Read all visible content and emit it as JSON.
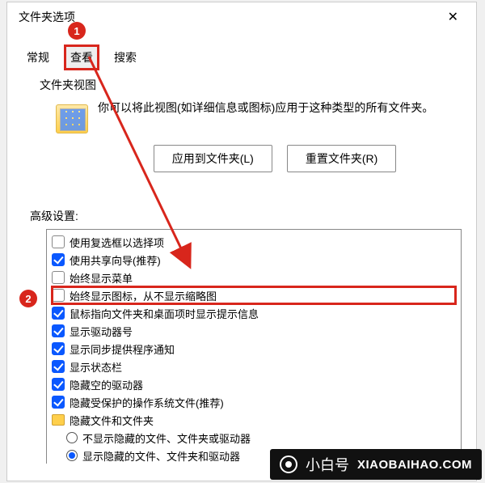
{
  "dialog": {
    "title": "文件夹选项",
    "close_tooltip": "关闭"
  },
  "tabs": {
    "general": "常规",
    "view": "查看",
    "search": "搜索"
  },
  "folder_views": {
    "group_label": "文件夹视图",
    "description": "你可以将此视图(如详细信息或图标)应用于这种类型的所有文件夹。",
    "apply_btn": "应用到文件夹(L)",
    "reset_btn": "重置文件夹(R)"
  },
  "advanced": {
    "label": "高级设置:",
    "items": [
      {
        "kind": "check",
        "checked": false,
        "label": "使用复选框以选择项"
      },
      {
        "kind": "check",
        "checked": true,
        "label": "使用共享向导(推荐)"
      },
      {
        "kind": "check",
        "checked": false,
        "label": "始终显示菜单"
      },
      {
        "kind": "check",
        "checked": false,
        "label": "始终显示图标，从不显示缩略图",
        "highlight": true
      },
      {
        "kind": "check",
        "checked": true,
        "label": "鼠标指向文件夹和桌面项时显示提示信息"
      },
      {
        "kind": "check",
        "checked": true,
        "label": "显示驱动器号"
      },
      {
        "kind": "check",
        "checked": true,
        "label": "显示同步提供程序通知"
      },
      {
        "kind": "check",
        "checked": true,
        "label": "显示状态栏"
      },
      {
        "kind": "check",
        "checked": true,
        "label": "隐藏空的驱动器"
      },
      {
        "kind": "check",
        "checked": true,
        "label": "隐藏受保护的操作系统文件(推荐)"
      },
      {
        "kind": "folder",
        "label": "隐藏文件和文件夹"
      },
      {
        "kind": "radio",
        "selected": false,
        "indent": 1,
        "label": "不显示隐藏的文件、文件夹或驱动器"
      },
      {
        "kind": "radio",
        "selected": true,
        "indent": 1,
        "label": "显示隐藏的文件、文件夹和驱动器"
      }
    ]
  },
  "annotations": {
    "step1": "1",
    "step2": "2"
  },
  "watermark": {
    "cn": "@小白号",
    "en": "XIAOBAIHAO.COM"
  },
  "brand": {
    "cn": "小白号",
    "en": "XIAOBAIHAO.COM"
  }
}
